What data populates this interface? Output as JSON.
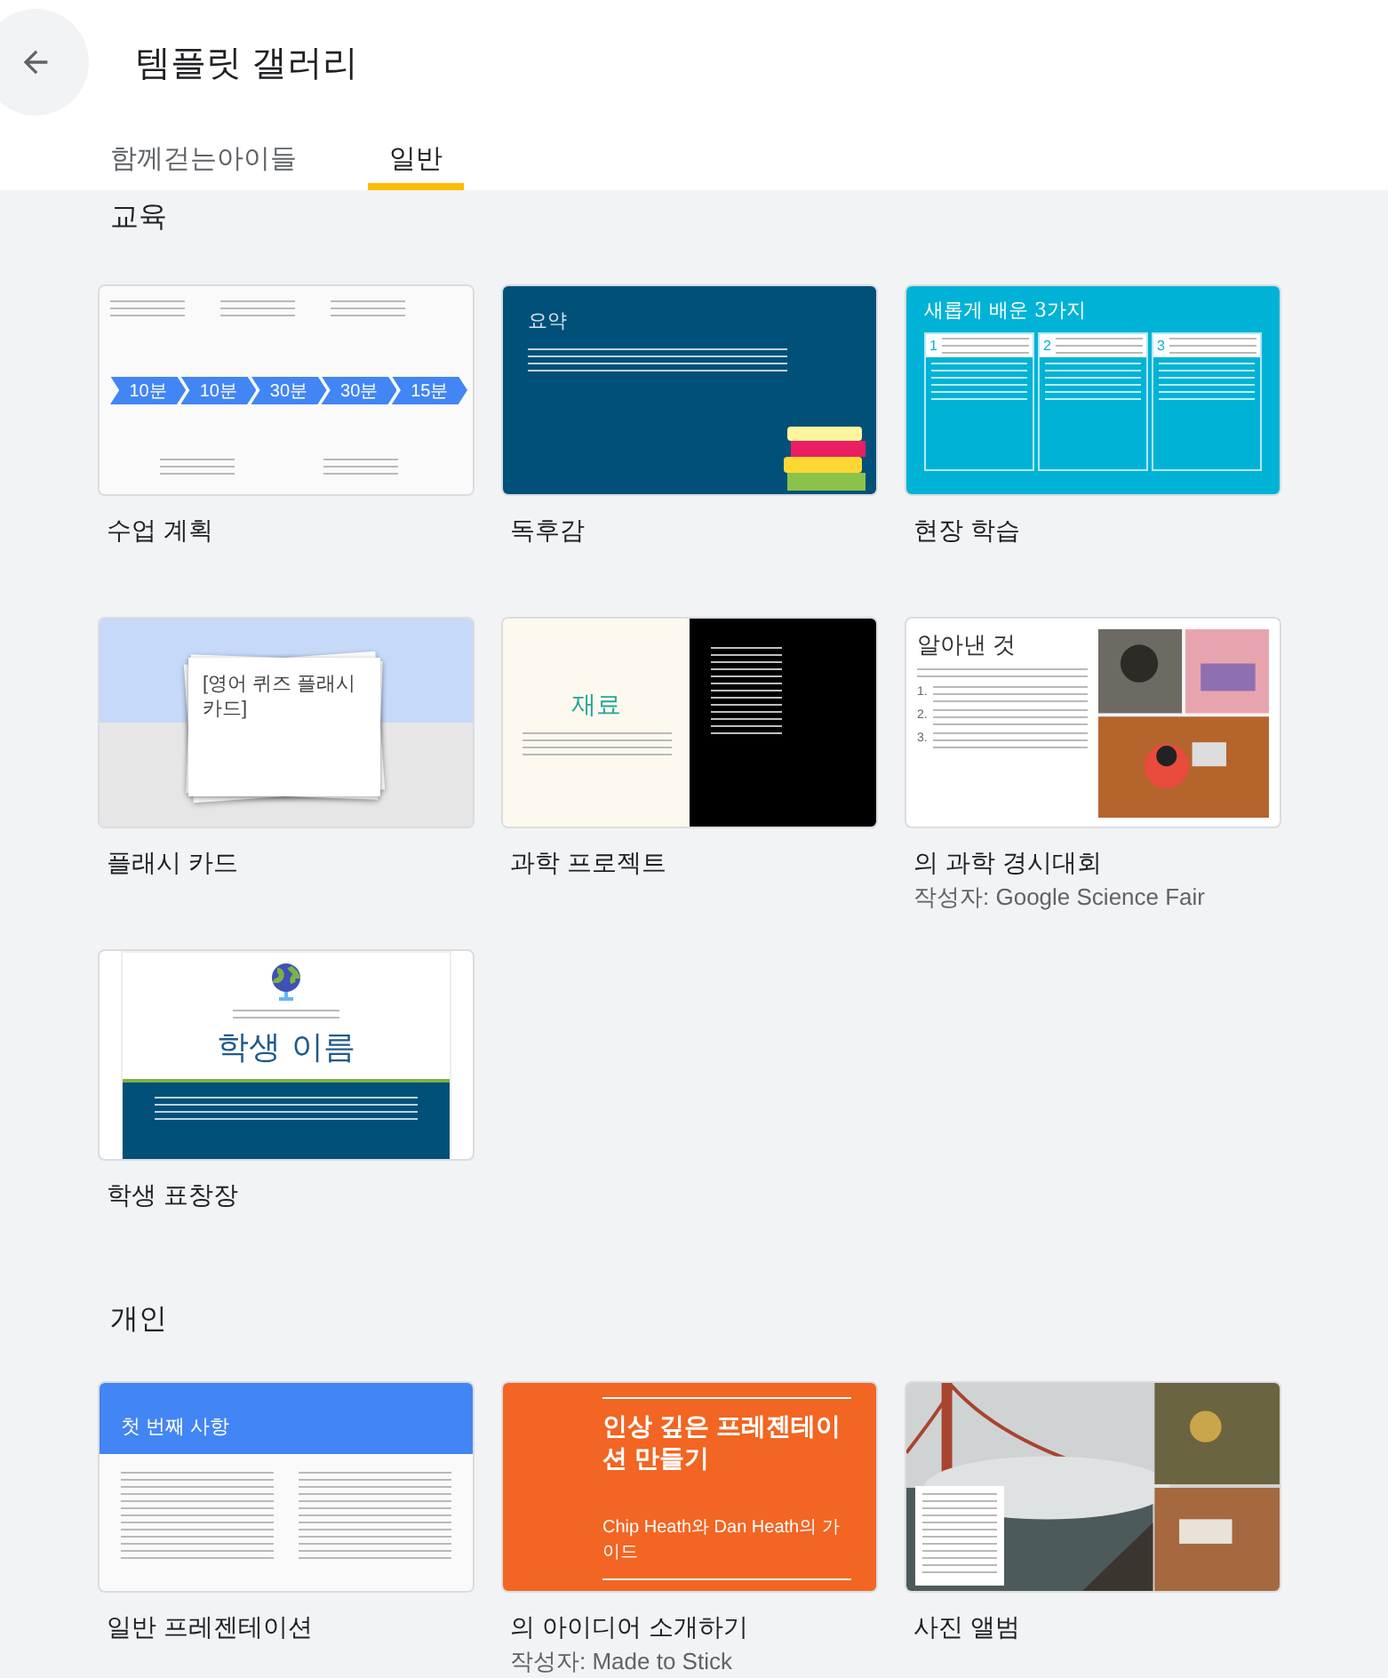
{
  "header": {
    "title": "템플릿 갤러리"
  },
  "tabs": [
    {
      "label": "함께걷는아이들",
      "selected": false
    },
    {
      "label": "일반",
      "selected": true
    }
  ],
  "sections": [
    {
      "title": "교육",
      "templates": [
        {
          "name": "수업 계획",
          "thumb": {
            "kind": "timeline",
            "steps": [
              "10분",
              "10분",
              "30분",
              "30분",
              "15분"
            ]
          }
        },
        {
          "name": "독후감",
          "thumb": {
            "kind": "report",
            "heading": "요약"
          }
        },
        {
          "name": "현장 학습",
          "thumb": {
            "kind": "fieldtrip",
            "heading": "새롭게 배운 3가지",
            "columns": [
              "1",
              "2",
              "3"
            ]
          }
        },
        {
          "name": "플래시 카드",
          "thumb": {
            "kind": "flashcard",
            "heading": "[영어 퀴즈 플래시 카드]"
          }
        },
        {
          "name": "과학 프로젝트",
          "thumb": {
            "kind": "science",
            "heading": "재료"
          }
        },
        {
          "name": "의 과학 경시대회",
          "author": "작성자: Google Science Fair",
          "thumb": {
            "kind": "fair",
            "heading": "알아낸 것",
            "items": [
              "1.",
              "2.",
              "3."
            ]
          }
        },
        {
          "name": "학생 표창장",
          "thumb": {
            "kind": "award",
            "heading": "학생 이름"
          }
        }
      ]
    },
    {
      "title": "개인",
      "templates": [
        {
          "name": "일반 프레젠테이션",
          "thumb": {
            "kind": "plain",
            "heading": "첫 번째 사항"
          }
        },
        {
          "name": "의 아이디어 소개하기",
          "author": "작성자: Made to Stick",
          "thumb": {
            "kind": "pitch",
            "heading": "인상 깊은 프레젠테이션 만들기",
            "body": "Chip Heath와 Dan Heath의 가이드"
          }
        },
        {
          "name": "사진 앨범",
          "thumb": {
            "kind": "album"
          }
        }
      ]
    }
  ]
}
